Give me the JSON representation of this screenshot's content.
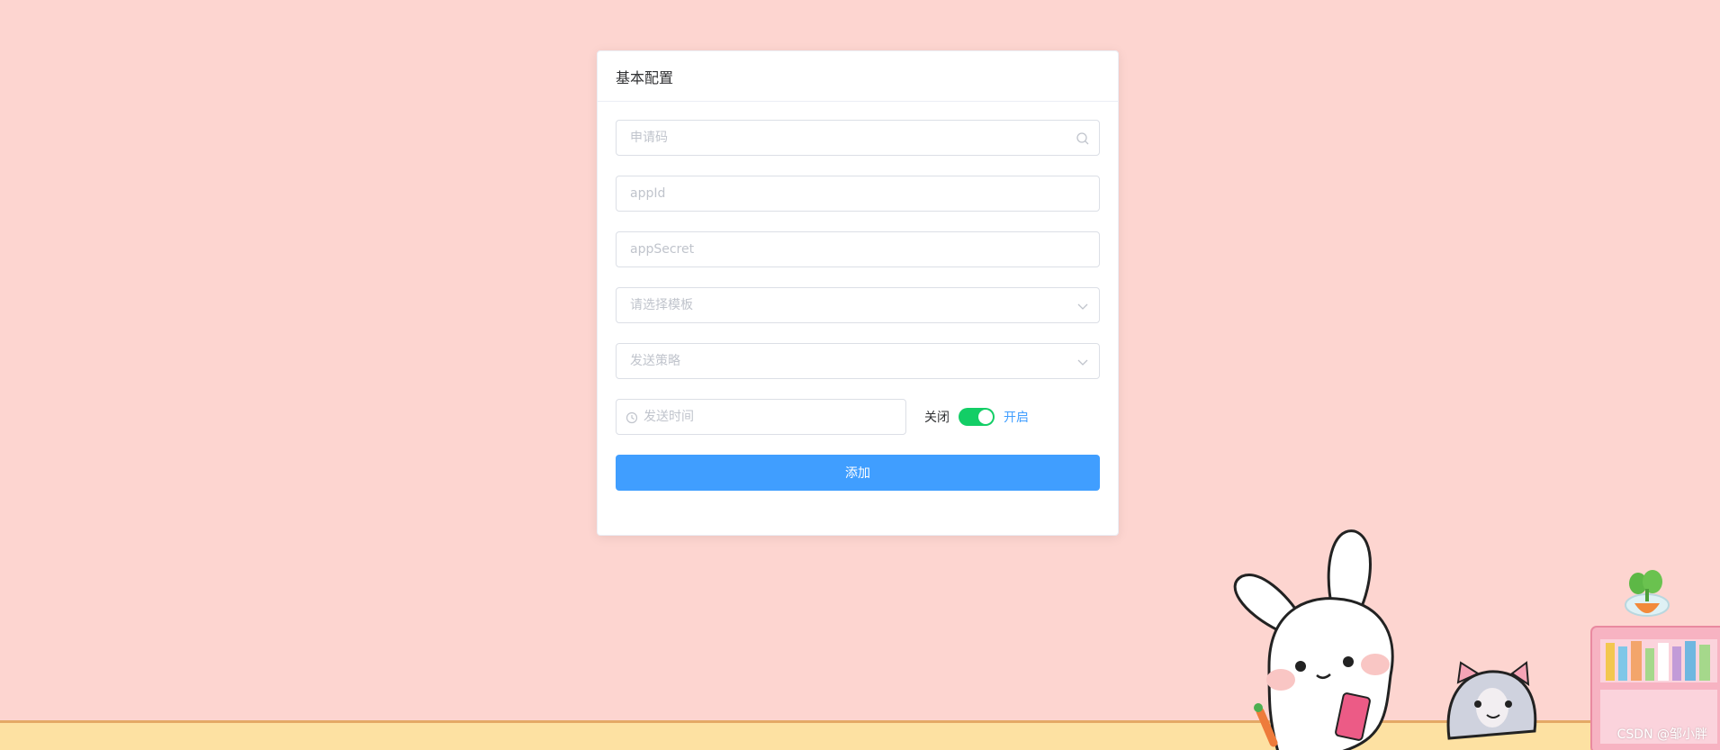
{
  "card": {
    "title": "基本配置"
  },
  "form": {
    "apply_code": {
      "placeholder": "申请码",
      "icon": "search-icon"
    },
    "app_id": {
      "placeholder": "appId"
    },
    "app_secret": {
      "placeholder": "appSecret"
    },
    "template_select": {
      "placeholder": "请选择模板",
      "icon": "chevron-down-icon"
    },
    "strategy_select": {
      "placeholder": "发送策略",
      "icon": "chevron-down-icon"
    },
    "send_time": {
      "placeholder": "发送时间",
      "icon": "clock-icon"
    },
    "switch": {
      "inactive_text": "关闭",
      "active_text": "开启",
      "state": "on"
    },
    "add_button_label": "添加"
  },
  "colors": {
    "background": "#fdd5d0",
    "primary": "#409eff",
    "switch_on": "#13ce66"
  },
  "watermark": "CSDN @邹小胖"
}
